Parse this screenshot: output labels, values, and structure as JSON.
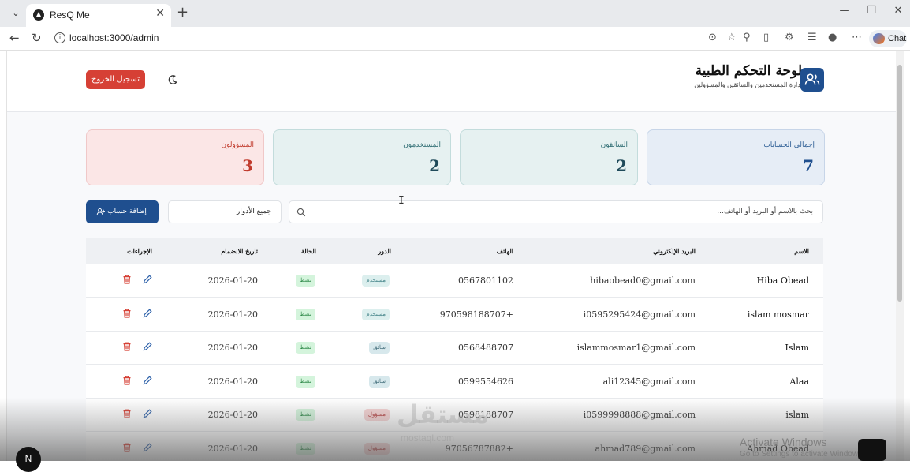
{
  "browser": {
    "tab_title": "ResQ Me",
    "url": "localhost:3000/admin",
    "chat_label": "Chat"
  },
  "header": {
    "title": "لوحة التحكم الطبية",
    "subtitle": "إدارة المستخدمين والسائقين والمسؤولين",
    "logout_label": "تسجيل الخروج"
  },
  "stats": [
    {
      "label": "إجمالي الحسابات",
      "value": "7",
      "bg": "#e6edf6",
      "border": "#c7d5e8",
      "label_color": "#2c5d94",
      "value_color": "#1f4f8f"
    },
    {
      "label": "السائقون",
      "value": "2",
      "bg": "#e6f1f1",
      "border": "#c3dcdc",
      "label_color": "#2f6d73",
      "value_color": "#1f4a5a"
    },
    {
      "label": "المستخدمون",
      "value": "2",
      "bg": "#e6f1f1",
      "border": "#c3dcdc",
      "label_color": "#2f6d73",
      "value_color": "#1f4a5a"
    },
    {
      "label": "المسؤولون",
      "value": "3",
      "bg": "#fbe6e6",
      "border": "#f0c8c8",
      "label_color": "#c0392b",
      "value_color": "#c0392b"
    }
  ],
  "controls": {
    "add_label": "إضافة حساب",
    "role_filter": "جميع الأدوار",
    "search_placeholder": "بحث بالاسم أو البريد أو الهاتف..."
  },
  "table": {
    "headers": {
      "name": "الاسم",
      "email": "البريد الإلكتروني",
      "phone": "الهاتف",
      "role": "الدور",
      "status": "الحالة",
      "joined": "تاريخ الانضمام",
      "actions": "الإجراءات"
    },
    "rows": [
      {
        "name": "Hiba Obead",
        "email": "hibaobead0@gmail.com",
        "phone": "0567801102",
        "role": "مستخدم",
        "status": "نشط",
        "joined": "2026-01-20"
      },
      {
        "name": "islam mosmar",
        "email": "i0595295424@gmail.com",
        "phone": "970598188707+",
        "role": "مستخدم",
        "status": "نشط",
        "joined": "2026-01-20"
      },
      {
        "name": "Islam",
        "email": "islammosmar1@gmail.com",
        "phone": "0568488707",
        "role": "سائق",
        "status": "نشط",
        "joined": "2026-01-20"
      },
      {
        "name": "Alaa",
        "email": "ali12345@gmail.com",
        "phone": "0599554626",
        "role": "سائق",
        "status": "نشط",
        "joined": "2026-01-20"
      },
      {
        "name": "islam",
        "email": "i0599998888@gmail.com",
        "phone": "0598188707",
        "role": "مسؤول",
        "status": "نشط",
        "joined": "2026-01-20"
      },
      {
        "name": "Ahmad Obead",
        "email": "ahmad789@gmail.com",
        "phone": "97056787882+",
        "role": "مسؤول",
        "status": "نشط",
        "joined": "2026-01-20"
      }
    ]
  },
  "overlay": {
    "watermark": "مستقل",
    "watermark_sub": "mostaql.com",
    "activate_title": "Activate Windows",
    "activate_sub": "Go to Settings to activate Windows.",
    "next_badge": "N"
  },
  "colors": {
    "primary": "#1f4f8f",
    "danger": "#d64035",
    "badge_user_bg": "#dcefee",
    "badge_driver_bg": "#d7e8ec",
    "badge_admin_bg": "#f6d4d4",
    "badge_active_bg": "#d4f4dc"
  },
  "icons": {
    "logo": "users-icon",
    "theme": "moon-icon",
    "add": "user-plus-icon",
    "search": "search-icon",
    "edit": "pencil-icon",
    "delete": "trash-icon"
  }
}
